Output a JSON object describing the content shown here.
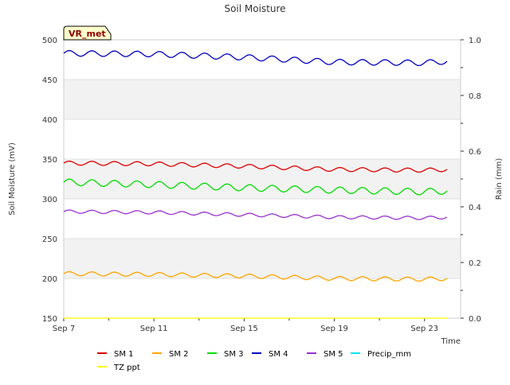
{
  "chart_data": {
    "type": "line",
    "title": "Soil Moisture",
    "xlabel": "Time",
    "ylabel": "Soil Moisture (mV)",
    "y2label": "Rain (mm)",
    "badge": "VR_met",
    "x_range_days": [
      0,
      17.6
    ],
    "x_ticks": [
      {
        "label": "Sep 7",
        "day": 0
      },
      {
        "label": "Sep 11",
        "day": 4
      },
      {
        "label": "Sep 15",
        "day": 8
      },
      {
        "label": "Sep 19",
        "day": 12
      },
      {
        "label": "Sep 23",
        "day": 16
      }
    ],
    "ylim": [
      150,
      500
    ],
    "y_ticks": [
      150,
      200,
      250,
      300,
      350,
      400,
      450,
      500
    ],
    "y2lim": [
      0,
      1.0
    ],
    "y2_ticks": [
      "0.0",
      "0.2",
      "0.4",
      "0.6",
      "0.8",
      "1.0"
    ],
    "grid": "horizontal bands",
    "legend_position": "bottom",
    "series": [
      {
        "name": "SM 1",
        "color": "#dd0000",
        "axis": "left",
        "days": [
          0,
          4,
          8,
          12,
          16,
          17
        ],
        "values": [
          345,
          344,
          341,
          337,
          336,
          337
        ],
        "amplitude": 2.5
      },
      {
        "name": "SM 2",
        "color": "#ffa500",
        "axis": "left",
        "days": [
          0,
          4,
          8,
          12,
          16,
          17
        ],
        "values": [
          206,
          205,
          203,
          200,
          199,
          200
        ],
        "amplitude": 2.5
      },
      {
        "name": "SM 3",
        "color": "#00dd00",
        "axis": "left",
        "days": [
          0,
          4,
          8,
          12,
          16,
          17
        ],
        "values": [
          321,
          318,
          314,
          311,
          309,
          310
        ],
        "amplitude": 4
      },
      {
        "name": "SM 4",
        "color": "#0000bb",
        "axis": "left",
        "days": [
          0,
          4,
          8,
          12,
          16,
          17
        ],
        "values": [
          483,
          482,
          478,
          472,
          471,
          473
        ],
        "amplitude": 3.5
      },
      {
        "name": "SM 5",
        "color": "#9932cc",
        "axis": "left",
        "days": [
          0,
          4,
          8,
          12,
          16,
          17
        ],
        "values": [
          284,
          283,
          280,
          277,
          276,
          277
        ],
        "amplitude": 2
      },
      {
        "name": "Precip_mm",
        "color": "#00e5ee",
        "axis": "right",
        "days": [],
        "values": [],
        "amplitude": 0
      },
      {
        "name": "TZ ppt",
        "color": "#ffff00",
        "axis": "left",
        "days": [
          0,
          17
        ],
        "values": [
          150,
          150
        ],
        "amplitude": 0
      }
    ]
  }
}
